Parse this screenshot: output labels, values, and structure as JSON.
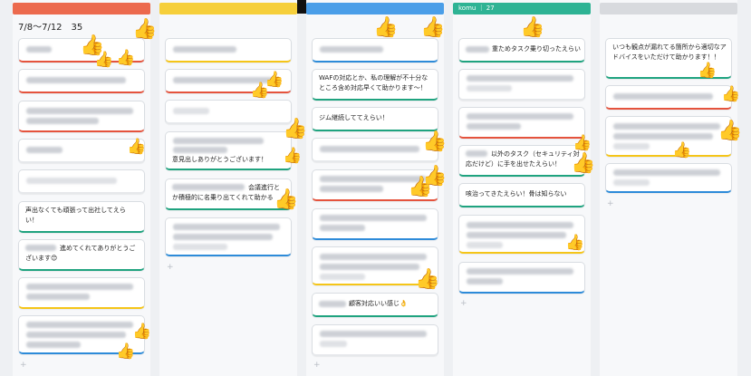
{
  "columns": [
    {
      "color": "#ec6a4e",
      "header": "",
      "title": "7/8〜7/12　35"
    },
    {
      "color": "#f6cf3b",
      "header": "",
      "title": ""
    },
    {
      "color": "#4a9ee8",
      "header": "",
      "title": ""
    },
    {
      "color": "#2eb394",
      "header": "komu ｜ 27",
      "title": ""
    },
    {
      "color": "#d8dade",
      "header": "",
      "title": ""
    }
  ],
  "cards": {
    "c1_6": "声出なくても頑張って出社してえらい！",
    "c1_7": "進めてくれてありがとうございます😊",
    "c2_4": "意見出しありがとうございます！",
    "c2_5": "会議進行とか積極的に名乗り出てくれて助かる",
    "c3_2": "WAFの対応とか、私の理解が不十分なところ含め対応早くて助かります〜！",
    "c3_3": "ジム継続しててえらい！",
    "c3_8": "顧客対応いい感じ👌",
    "c4_1": "重ためタスク乗り切ったえらい",
    "c4_4": "以外のタスク（セキュリティ対応だけど）に手を出せたえらい！",
    "c4_5": "咳治ってきたえらい！骨は知らない",
    "c5_1": "いつも観点が漏れてる箇所から適切なアドバイスをいただけて助かります！！"
  },
  "plus": "+",
  "thumb": "👍"
}
